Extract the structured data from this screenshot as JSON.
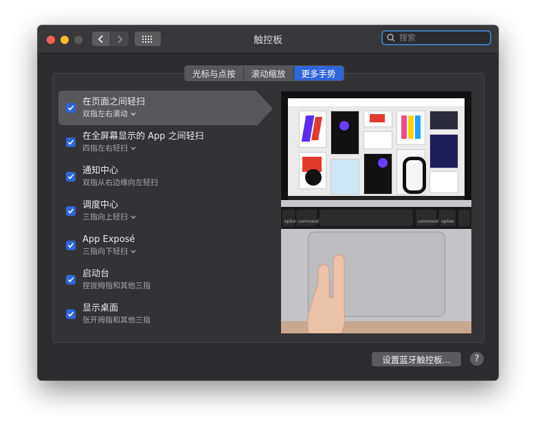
{
  "window": {
    "title": "触控板"
  },
  "search": {
    "placeholder": "搜索"
  },
  "tabs": [
    {
      "label": "光标与点按",
      "active": false
    },
    {
      "label": "滚动缩放",
      "active": false
    },
    {
      "label": "更多手势",
      "active": true
    }
  ],
  "gestures": [
    {
      "title": "在页面之间轻扫",
      "subtitle": "双指左右滚动",
      "has_menu": true,
      "checked": true,
      "selected": true
    },
    {
      "title": "在全屏幕显示的 App 之间轻扫",
      "subtitle": "四指左右轻扫",
      "has_menu": true,
      "checked": true,
      "selected": false
    },
    {
      "title": "通知中心",
      "subtitle": "双指从右边缘向左轻扫",
      "has_menu": false,
      "checked": true,
      "selected": false
    },
    {
      "title": "调度中心",
      "subtitle": "三指向上轻扫",
      "has_menu": true,
      "checked": true,
      "selected": false
    },
    {
      "title": "App Exposé",
      "subtitle": "三指向下轻扫",
      "has_menu": true,
      "checked": true,
      "selected": false
    },
    {
      "title": "启动台",
      "subtitle": "捏拢拇指和其他三指",
      "has_menu": false,
      "checked": true,
      "selected": false
    },
    {
      "title": "显示桌面",
      "subtitle": "张开拇指和其他三指",
      "has_menu": false,
      "checked": true,
      "selected": false
    }
  ],
  "footer": {
    "bluetooth_button": "设置蓝牙触控板...",
    "help_button": "?"
  },
  "preview": {
    "keys": {
      "option_left": "option",
      "command_left": "command",
      "command_right": "command",
      "option_right": "option"
    }
  },
  "colors": {
    "accent": "#2f66d8",
    "window_bg": "#2c2c2e",
    "selected_row": "#58585b"
  }
}
